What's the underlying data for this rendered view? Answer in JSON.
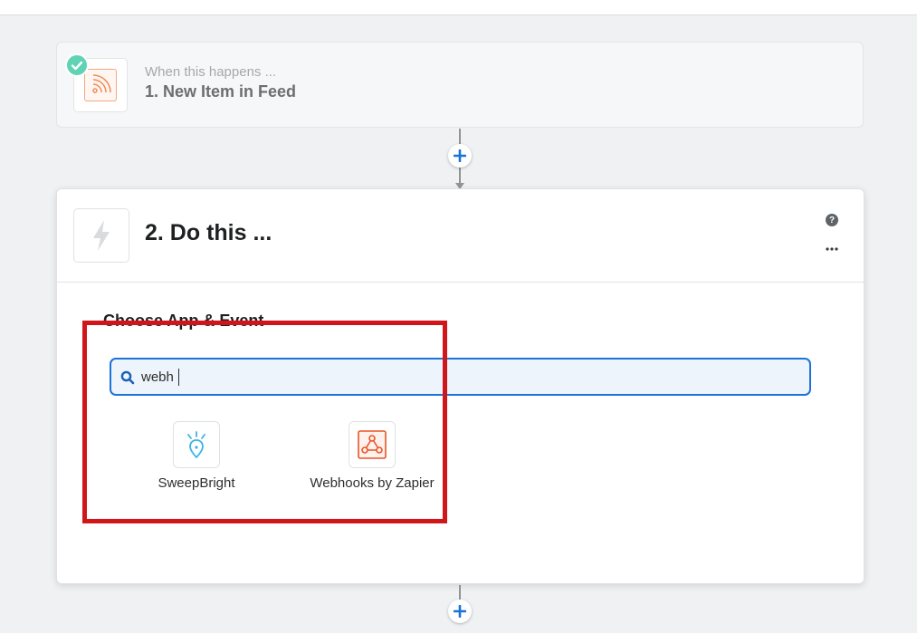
{
  "trigger": {
    "subtitle": "When this happens ...",
    "title": "1. New Item in Feed",
    "icon": "rss-icon",
    "status_icon": "check-icon"
  },
  "action": {
    "title": "2. Do this ...",
    "icon": "bolt-icon",
    "help_icon": "question-icon",
    "more_icon": "more-icon",
    "section_heading": "Choose App & Event",
    "search": {
      "value": "webh",
      "placeholder": ""
    },
    "results": [
      {
        "label": "SweepBright",
        "icon": "sweepbright-icon"
      },
      {
        "label": "Webhooks by Zapier",
        "icon": "webhooks-icon"
      }
    ]
  },
  "colors": {
    "accent": "#1a73d9",
    "check_badge": "#5fd3b4",
    "rss_orange": "#f28a56",
    "webhook_orange": "#e8552a",
    "sweepbright_blue": "#3ab5e6",
    "highlight_red": "#d0161b"
  }
}
